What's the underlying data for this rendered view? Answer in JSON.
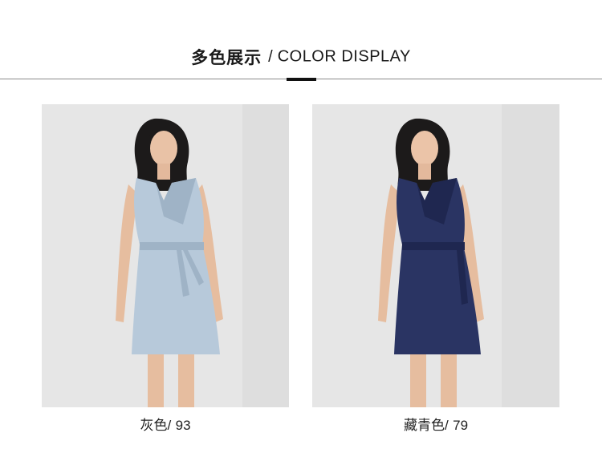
{
  "header": {
    "title_cn": "多色展示",
    "separator": "/",
    "title_en": "COLOR DISPLAY"
  },
  "products": [
    {
      "color_name": "灰色",
      "separator": "/",
      "code": "93",
      "dress_color": "#b7c9da",
      "dress_shadow": "#9fb3c6"
    },
    {
      "color_name": "藏青色",
      "separator": "/",
      "code": "79",
      "dress_color": "#2a3463",
      "dress_shadow": "#1f2750"
    }
  ],
  "colors": {
    "background": "#ffffff",
    "card_bg": "#e4e4e4",
    "divider": "#8a8a8a",
    "accent": "#111111"
  }
}
